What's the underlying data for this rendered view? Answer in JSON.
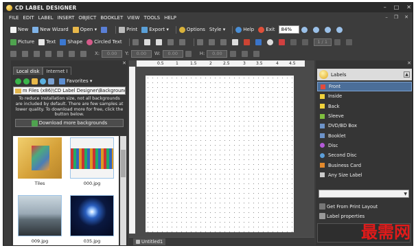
{
  "app": {
    "title": "CD LABEL DESIGNER"
  },
  "menu": [
    "FILE",
    "EDIT",
    "LABEL",
    "INSERT",
    "OBJECT",
    "BOOKLET",
    "VIEW",
    "TOOLS",
    "HELP"
  ],
  "toolbar1": {
    "new": "New",
    "new_wizard": "New Wizard",
    "open": "Open",
    "print": "Print",
    "export": "Export",
    "options": "Options",
    "style": "Style",
    "help": "Help",
    "exit": "Exit",
    "zoom": "84%"
  },
  "toolbar2": {
    "picture": "Picture",
    "text": "Text",
    "shape": "Shape",
    "circled_text": "Circled Text",
    "page": "1 / 1"
  },
  "toolbar3": {
    "x_label": "X:",
    "x": "0.00",
    "y_label": "Y:",
    "y": "0.00",
    "w_label": "W:",
    "w": "0.00",
    "h_label": "H:",
    "h": "0.00"
  },
  "left_panel": {
    "tabs": [
      "Local disk",
      "Internet I"
    ],
    "favorites": "Favorites",
    "path": "m Files (x86)\\CD Label Designer\\Backgrounds",
    "info": "To reduce installation size, not all backgrounds are included by default. There are few samples at lower quality. To download more for free, click the button below.",
    "download_btn": "Download more backgrounds",
    "thumbs": [
      "Tiles",
      "000.jpg",
      "009.jpg",
      "035.jpg"
    ]
  },
  "ruler": [
    "0.5",
    "1",
    "1.5",
    "2",
    "2.5",
    "3",
    "3.5",
    "4",
    "4.5"
  ],
  "document_tab": "Untitled1",
  "right_panel": {
    "header": "Labels",
    "items": [
      {
        "label": "Front",
        "color": "#e24b3c"
      },
      {
        "label": "Inside",
        "color": "#f0d23c"
      },
      {
        "label": "Back",
        "color": "#f0d23c"
      },
      {
        "label": "Sleeve",
        "color": "#7fbf3f"
      },
      {
        "label": "DVD/BD Box",
        "color": "#6d93c9"
      },
      {
        "label": "Booklet",
        "color": "#6d93c9"
      },
      {
        "label": "Disc",
        "color": "#b45ad8"
      },
      {
        "label": "Second Disc",
        "color": "#5c9ed8"
      },
      {
        "label": "Business Card",
        "color": "#e48a2c"
      },
      {
        "label": "Any Size Label",
        "color": "#cccccc"
      }
    ],
    "from_print_layout": "Get From Print Layout",
    "label_properties": "Label properties"
  },
  "watermark": "最需网"
}
